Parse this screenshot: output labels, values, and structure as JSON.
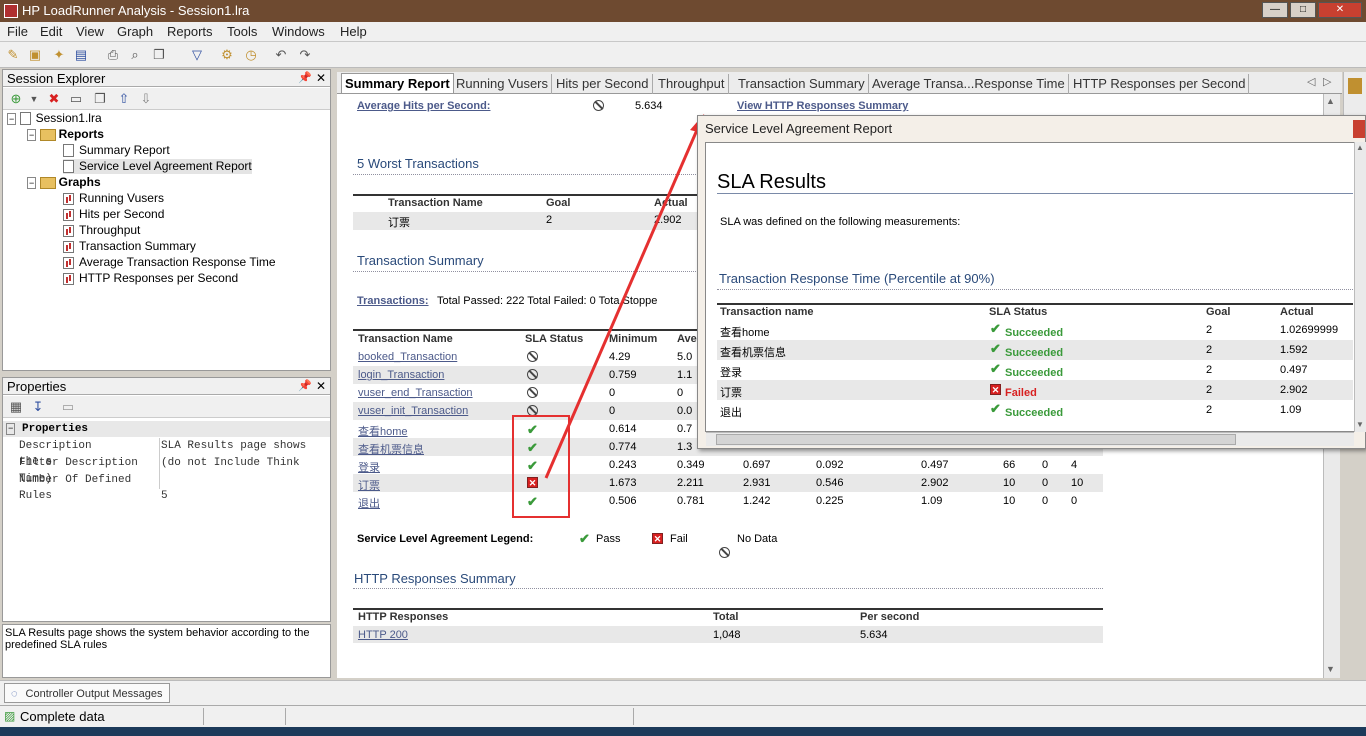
{
  "window": {
    "title": "HP LoadRunner Analysis - Session1.lra"
  },
  "menu": [
    "File",
    "Edit",
    "View",
    "Graph",
    "Reports",
    "Tools",
    "Windows",
    "Help"
  ],
  "session_explorer": {
    "title": "Session Explorer",
    "root": "Session1.lra",
    "reports_label": "Reports",
    "reports": [
      "Summary Report",
      "Service Level Agreement Report"
    ],
    "graphs_label": "Graphs",
    "graphs": [
      "Running Vusers",
      "Hits per Second",
      "Throughput",
      "Transaction Summary",
      "Average Transaction Response Time",
      "HTTP Responses per Second"
    ]
  },
  "properties": {
    "title": "Properties",
    "section": "Properties",
    "rows": [
      {
        "name": "Description",
        "value": "SLA Results page shows the s"
      },
      {
        "name": "Filter Description",
        "value": "(do not Include Think Time)"
      },
      {
        "name": "Number Of Defined Rules",
        "value": "5"
      }
    ],
    "description": "SLA Results page shows the system behavior according to the predefined SLA rules"
  },
  "tabs": [
    "Summary Report",
    "Running Vusers",
    "Hits per Second",
    "Throughput",
    "Transaction Summary",
    "Average Transa...Response Time",
    "HTTP Responses per Second"
  ],
  "report": {
    "avg_hits_label": "Average Hits per Second:",
    "avg_hits_value": "5.634",
    "view_http_link": "View HTTP Responses Summary",
    "worst_title": "5 Worst Transactions",
    "worst_headers": [
      "Transaction Name",
      "Goal",
      "Actual"
    ],
    "worst_row": [
      "订票",
      "2",
      "2.902"
    ],
    "ts_title": "Transaction Summary",
    "ts_line_link": "Transactions:",
    "ts_line_text": "Total Passed: 222 Total Failed: 0 Tota Stoppe",
    "ts_headers": [
      "Transaction Name",
      "SLA Status",
      "Minimum",
      "Ave"
    ],
    "ts_rows": [
      {
        "name": "booked_Transaction",
        "status": "nodata",
        "c1": "4.29",
        "c2": "5.0"
      },
      {
        "name": "login_Transaction",
        "status": "nodata",
        "c1": "0.759",
        "c2": "1.1"
      },
      {
        "name": "vuser_end_Transaction",
        "status": "nodata",
        "c1": "0",
        "c2": "0"
      },
      {
        "name": "vuser_init_Transaction",
        "status": "nodata",
        "c1": "0",
        "c2": "0.0"
      },
      {
        "name": "查看home",
        "status": "pass",
        "c1": "0.614",
        "c2": "0.7"
      },
      {
        "name": "查看机票信息",
        "status": "pass",
        "c1": "0.774",
        "c2": "1.3"
      },
      {
        "name": "登录",
        "status": "pass",
        "c1": "0.243",
        "c2": "0.349",
        "c3": "0.697",
        "c4": "0.092",
        "c5": "0.497",
        "c6": "66",
        "c7": "0",
        "c8": "4"
      },
      {
        "name": "订票",
        "status": "fail",
        "c1": "1.673",
        "c2": "2.211",
        "c3": "2.931",
        "c4": "0.546",
        "c5": "2.902",
        "c6": "10",
        "c7": "0",
        "c8": "10"
      },
      {
        "name": "退出",
        "status": "pass",
        "c1": "0.506",
        "c2": "0.781",
        "c3": "1.242",
        "c4": "0.225",
        "c5": "1.09",
        "c6": "10",
        "c7": "0",
        "c8": "0"
      }
    ],
    "legend_label": "Service Level Agreement Legend:",
    "legend_pass": "Pass",
    "legend_fail": "Fail",
    "legend_nodata": "No Data",
    "http_title": "HTTP Responses Summary",
    "http_headers": [
      "HTTP Responses",
      "Total",
      "Per second"
    ],
    "http_row": [
      "HTTP 200",
      "1,048",
      "5.634"
    ]
  },
  "sla_popup": {
    "window_title": "Service Level Agreement Report",
    "heading": "SLA Results",
    "intro": "SLA was defined on the following measurements:",
    "section": "Transaction Response Time (Percentile at 90%)",
    "headers": [
      "Transaction name",
      "SLA Status",
      "Goal",
      "Actual"
    ],
    "rows": [
      {
        "name": "查看home",
        "status": "Succeeded",
        "goal": "2",
        "actual": "1.02699999",
        "failed": false
      },
      {
        "name": "查看机票信息",
        "status": "Succeeded",
        "goal": "2",
        "actual": "1.592",
        "failed": false
      },
      {
        "name": "登录",
        "status": "Succeeded",
        "goal": "2",
        "actual": "0.497",
        "failed": false
      },
      {
        "name": "订票",
        "status": "Failed",
        "goal": "2",
        "actual": "2.902",
        "failed": true
      },
      {
        "name": "退出",
        "status": "Succeeded",
        "goal": "2",
        "actual": "1.09",
        "failed": false
      }
    ]
  },
  "bottom_tab": "Controller Output Messages",
  "status": "Complete data",
  "colors": {
    "pass": "#3a9a3a",
    "fail": "#d82020",
    "annotation": "#e53030",
    "link": "#4c5a8a",
    "header": "#2a4a7a"
  }
}
